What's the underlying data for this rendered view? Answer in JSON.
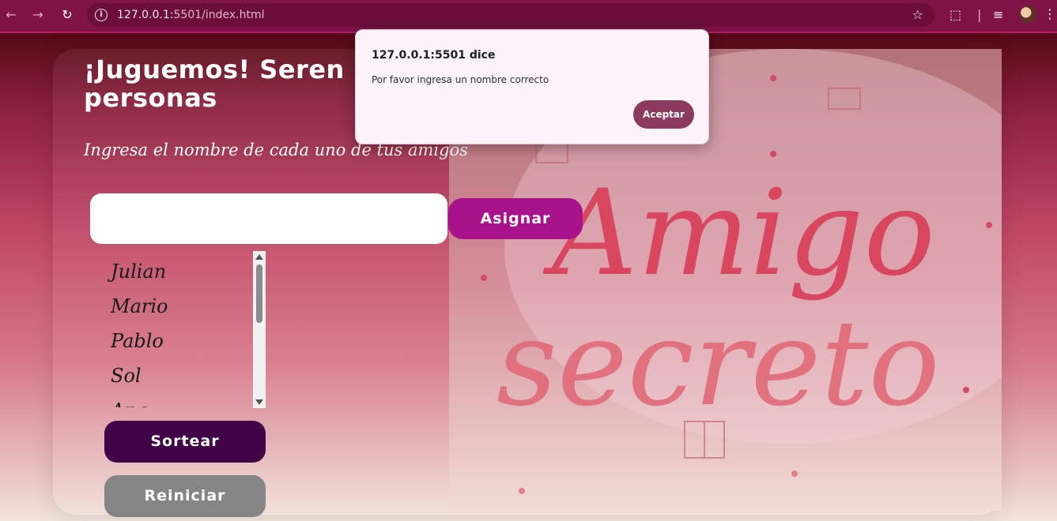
{
  "browser": {
    "url_host": "127.0.0.1:",
    "url_rest": "5501/index.html"
  },
  "page": {
    "title": "¡Juguemos! Serenos personas",
    "title_line1": "¡Juguemos! Seren",
    "title_line2": "personas",
    "subtitle": "Ingresa el nombre de cada uno de tus amigos",
    "input_value": "",
    "assign_label": "Asignar",
    "friends": [
      "Julian",
      "Mario",
      "Pablo",
      "Sol",
      "Ana"
    ],
    "draw_label": "Sortear",
    "reset_label": "Reiniciar",
    "hero_text": "Amigo secreto"
  },
  "dialog": {
    "title": "127.0.0.1:5501 dice",
    "message": "Por favor ingresa un nombre correcto",
    "accept_label": "Aceptar"
  },
  "colors": {
    "accent_assign": "#a8138c",
    "accent_draw": "#410347",
    "reset": "#858585"
  }
}
